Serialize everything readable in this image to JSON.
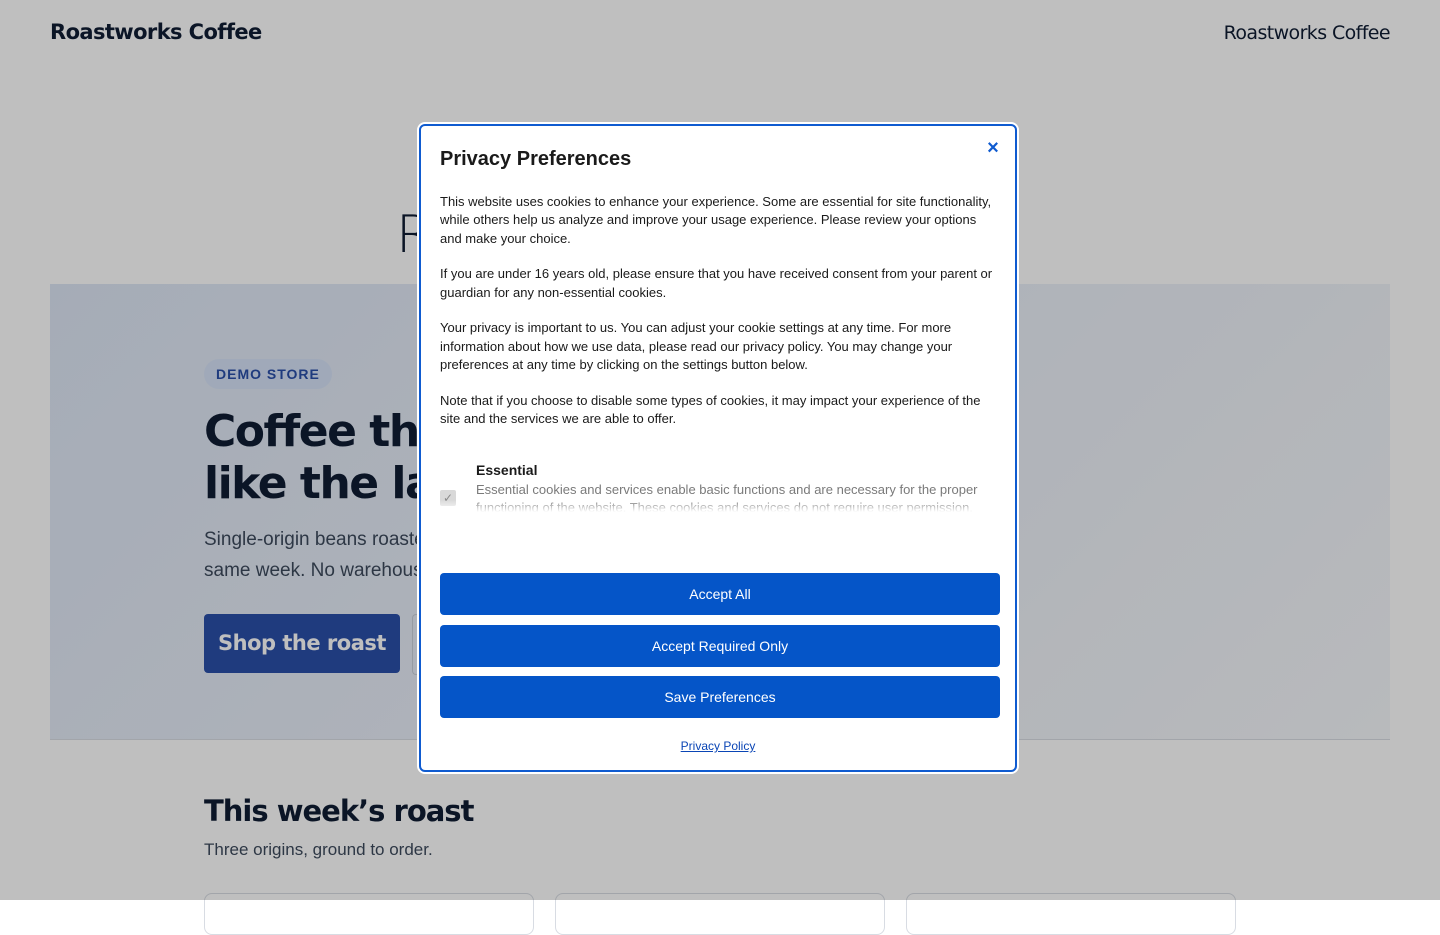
{
  "header": {
    "logo": "Roastworks Coffee",
    "right_logo": "Roastworks Coffee"
  },
  "background": {
    "big_heading_partial": "R",
    "hero": {
      "badge": "DEMO STORE",
      "title_line1": "Coffee that",
      "title_line2": "like the labe",
      "subtitle_line1": "Single-origin beans roaste",
      "subtitle_line2": "same week. No warehouse",
      "shop_button": "Shop the roast"
    },
    "section": {
      "title": "This week’s roast",
      "subtitle": "Three origins, ground to order."
    }
  },
  "modal": {
    "title": "Privacy Preferences",
    "close_icon": "×",
    "paragraphs": [
      "This website uses cookies to enhance your experience. Some are essential for site functionality, while others help us analyze and improve your usage experience. Please review your options and make your choice.",
      "If you are under 16 years old, please ensure that you have received consent from your parent or guardian for any non-essential cookies.",
      "Your privacy is important to us. You can adjust your cookie settings at any time. For more information about how we use data, please read our privacy policy. You may change your preferences at any time by clicking on the settings button below.",
      "Note that if you choose to disable some types of cookies, it may impact your experience of the site and the services we are able to offer."
    ],
    "category": {
      "title": "Essential",
      "description": "Essential cookies and services enable basic functions and are necessary for the proper functioning of the website. These cookies and services do not require user permission.",
      "checked_icon": "✓"
    },
    "buttons": {
      "accept_all": "Accept All",
      "accept_required": "Accept Required Only",
      "save_preferences": "Save Preferences"
    },
    "privacy_link": "Privacy Policy"
  },
  "colors": {
    "accent": "#0555c8",
    "brand": "#2a4fa8"
  }
}
